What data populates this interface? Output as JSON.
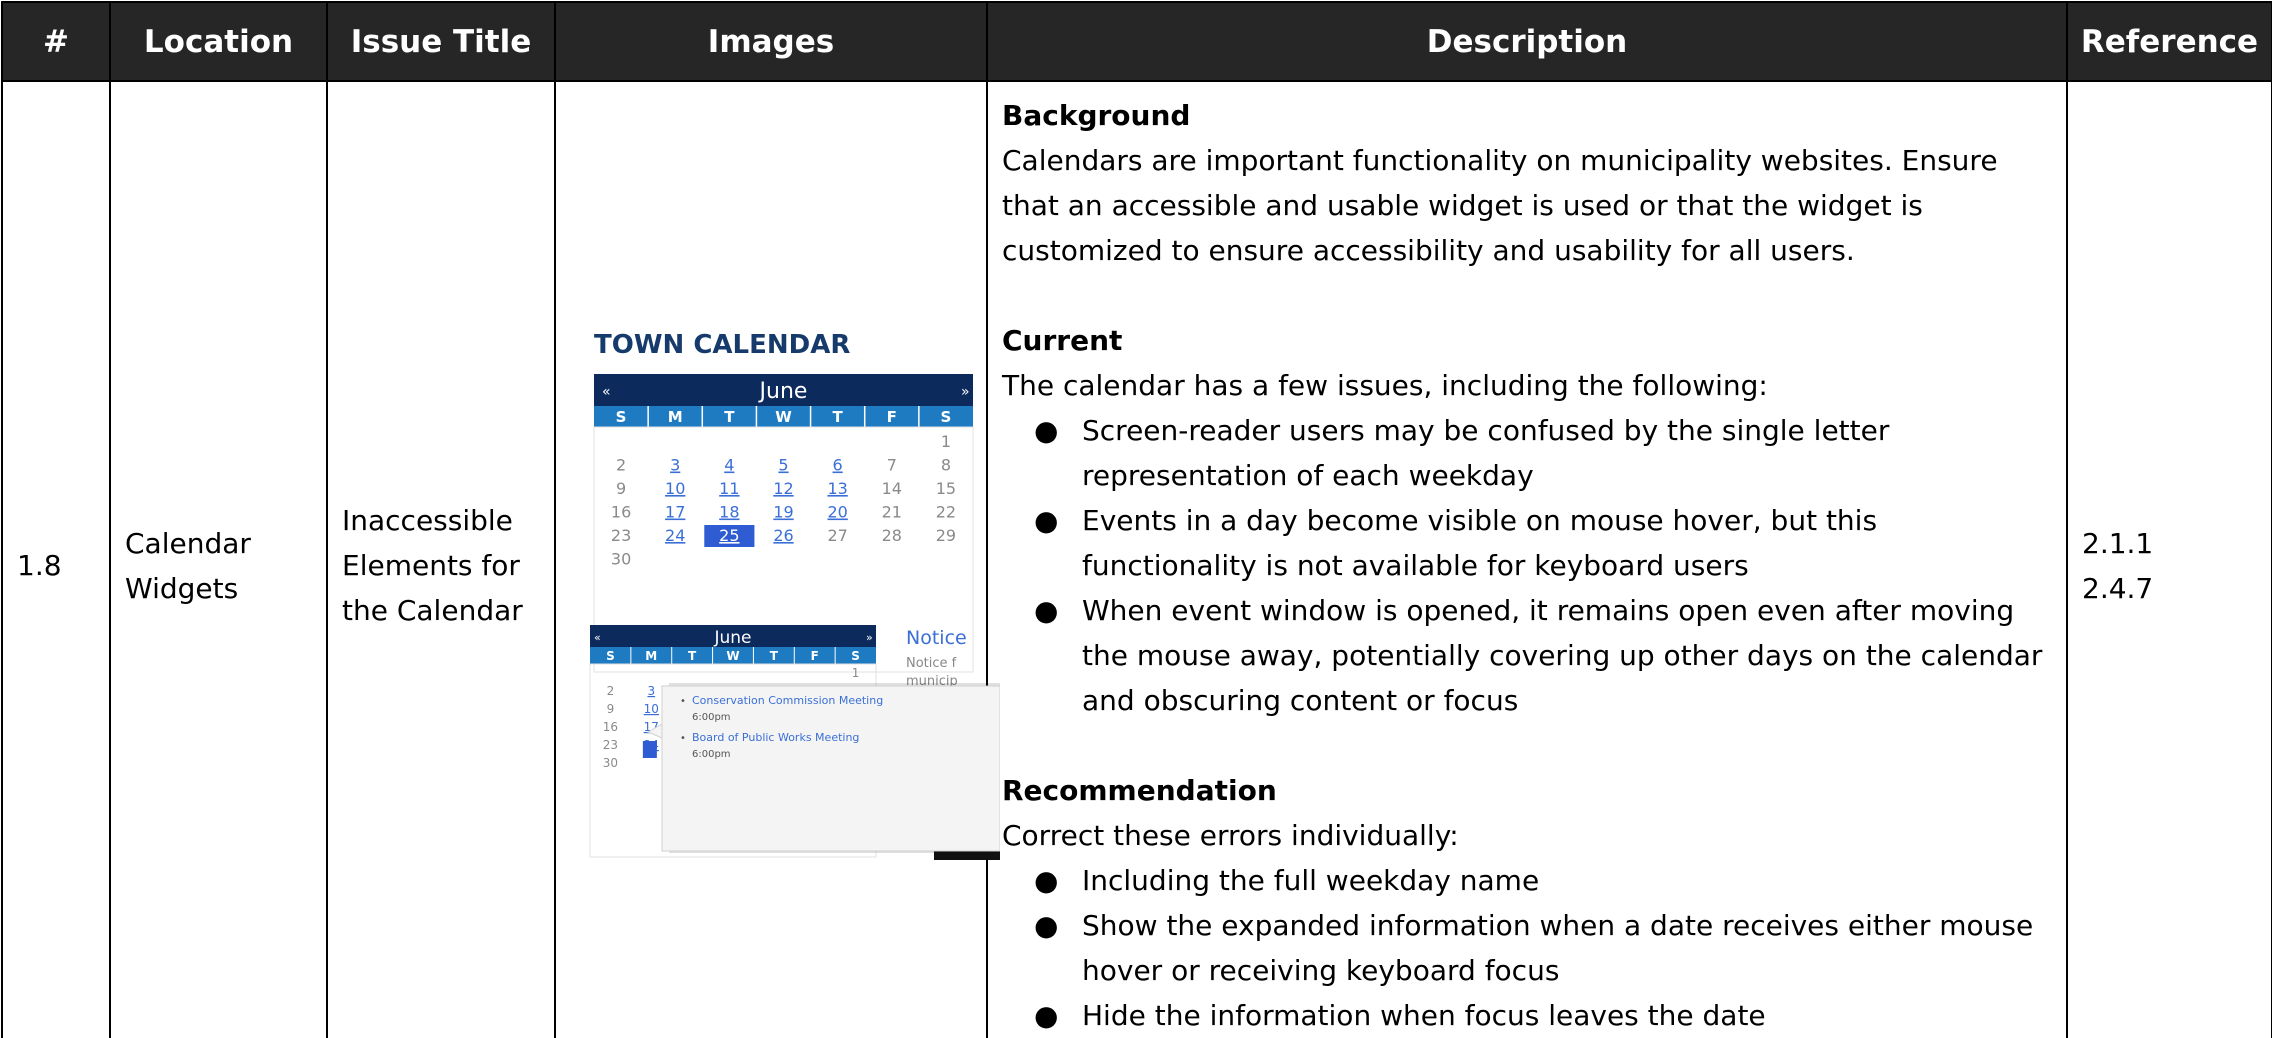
{
  "table": {
    "headers": [
      "#",
      "Location",
      "Issue Title",
      "Images",
      "Description",
      "Reference"
    ],
    "row": {
      "number": "1.8",
      "location_lines": [
        "Calendar",
        "Widgets"
      ],
      "issue_title_lines": [
        "Inaccessible",
        "Elements for",
        "the Calendar"
      ],
      "references": [
        "2.1.1",
        "2.4.7"
      ],
      "description": {
        "background_heading": "Background",
        "background_text": "Calendars are important functionality on municipality websites. Ensure that an accessible and usable widget is used or that the widget is customized to ensure accessibility and usability for all users.",
        "current_heading": "Current",
        "current_intro": "The calendar has a few issues, including the following:",
        "current_items": [
          "Screen-reader users may be confused by the single letter representation of each weekday",
          "Events in a day become visible on mouse hover, but this functionality is not available for keyboard users",
          "When event window is opened, it remains open even after moving the mouse away, potentially covering up other days on the calendar and obscuring content or focus"
        ],
        "recommendation_heading": "Recommendation",
        "recommendation_intro": "Correct these errors individually:",
        "recommendation_items": [
          "Including the full weekday name",
          "Show the expanded information when a date receives either mouse hover or receiving keyboard focus",
          "Hide the information when focus leaves the date"
        ]
      }
    }
  },
  "images": {
    "calendar_title": "TOWN CALENDAR",
    "month": "June",
    "prev_glyph": "«",
    "next_glyph": "»",
    "weekdays": [
      "S",
      "M",
      "T",
      "W",
      "T",
      "F",
      "S"
    ],
    "weeks": [
      [
        "",
        "",
        "",
        "",
        "",
        "",
        "1"
      ],
      [
        "2",
        "3",
        "4",
        "5",
        "6",
        "7",
        "8"
      ],
      [
        "9",
        "10",
        "11",
        "12",
        "13",
        "14",
        "15"
      ],
      [
        "16",
        "17",
        "18",
        "19",
        "20",
        "21",
        "22"
      ],
      [
        "23",
        "24",
        "25",
        "26",
        "27",
        "28",
        "29"
      ],
      [
        "30",
        "",
        "",
        "",
        "",
        "",
        ""
      ]
    ],
    "linked_days": [
      "3",
      "4",
      "5",
      "6",
      "10",
      "11",
      "12",
      "13",
      "17",
      "18",
      "19",
      "20",
      "24",
      "25",
      "26"
    ],
    "selected_day": "25",
    "second_weeks": [
      [
        "",
        "",
        "",
        "",
        "",
        "",
        "1"
      ],
      [
        "2",
        "3",
        "",
        "",
        "",
        "",
        ""
      ],
      [
        "9",
        "10",
        "",
        "",
        "",
        "",
        ""
      ],
      [
        "16",
        "17",
        "",
        "",
        "",
        "",
        ""
      ],
      [
        "23",
        "24",
        "",
        "",
        "",
        "",
        ""
      ],
      [
        "30",
        "",
        "",
        "",
        "",
        "",
        ""
      ]
    ],
    "notice_heading": "Notice",
    "notice_text_lines": [
      "Notice f",
      "municip"
    ],
    "popup_events": [
      {
        "title": "Conservation Commission Meeting",
        "time": "6:00pm"
      },
      {
        "title": "Board of Public Works Meeting",
        "time": "6:00pm"
      }
    ],
    "colors": {
      "header_bg": "#262626",
      "calendar_navy": "#0d2a5c",
      "weekday_blue": "#1f7bc1",
      "title_navy": "#163a6b",
      "link_blue": "#3a6fd8",
      "selected_bg": "#2f5bd3",
      "muted_gray": "#8a8a8a"
    }
  }
}
